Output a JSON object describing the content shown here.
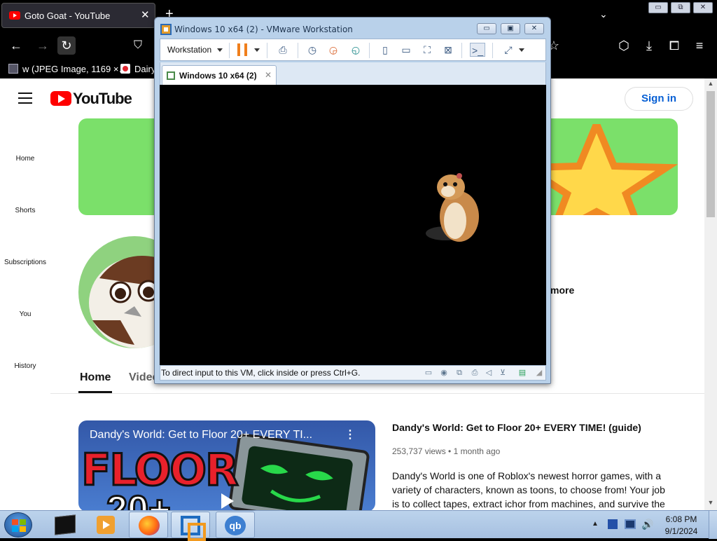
{
  "browser": {
    "tab_title": "Goto Goat - YouTube",
    "tab_close": "✕",
    "new_tab": "+",
    "tabs_list": "⌄",
    "window_min": "▭",
    "window_restore": "⧉",
    "window_close": "✕",
    "nav": {
      "back": "←",
      "forward": "→",
      "reload": "↻",
      "shield": "⛉",
      "star": "☆",
      "pocket": "⬡",
      "download": "⤓",
      "extensions": "⧠",
      "menu": "≡"
    },
    "bookmarks": [
      {
        "label": "w (JPEG Image, 1169 ×…",
        "icon": "image-icon"
      },
      {
        "label": "Dairy",
        "icon": "dairy-queen-icon"
      }
    ]
  },
  "youtube": {
    "logo_text": "YouTube",
    "signin": "Sign in",
    "sidebar": [
      {
        "label": "Home"
      },
      {
        "label": "Shorts"
      },
      {
        "label": "Subscriptions"
      },
      {
        "label": "You"
      },
      {
        "label": "History"
      }
    ],
    "more": "more",
    "tabs": {
      "home": "Home",
      "videos": "Video"
    },
    "video": {
      "thumb_title": "Dandy's World: Get to Floor 20+ EVERY TI...",
      "thumb_more": "⋮",
      "thumb_floor": "FLOOR",
      "thumb_number": "20+",
      "title": "Dandy's World: Get to Floor 20+ EVERY TIME! (guide)",
      "meta": "253,737 views • 1 month ago",
      "description": "Dandy's World is one of Roblox's newest horror games, with a variety of characters, known as toons, to choose from! Your job is to collect tapes, extract ichor from machines, and survive the"
    },
    "scroll_up": "▲",
    "scroll_down": "▼"
  },
  "vmware": {
    "title": "Windows 10 x64 (2) - VMware Workstation",
    "min": "▭",
    "max": "▣",
    "close": "✕",
    "toolbar": {
      "workstation_menu": "Workstation",
      "icons": [
        "send-keys-icon",
        "snapshot-icon",
        "revert-snapshot-icon",
        "snapshot-manager-icon",
        "library-icon",
        "single-window-icon",
        "fullscreen-icon",
        "unity-icon",
        "console-icon",
        "stretch-icon"
      ]
    },
    "tab_label": "Windows 10 x64 (2)",
    "tab_close": "✕",
    "status_text": "To direct input to this VM, click inside or press Ctrl+G."
  },
  "taskbar": {
    "tray_expand": "▲",
    "volume": "🔊",
    "time": "6:08 PM",
    "date": "9/1/2024",
    "qb_label": "qb"
  },
  "colors": {
    "youtube_red": "#ff0000",
    "signin_blue": "#065fd4",
    "banner_green": "#7be06a",
    "vmware_frame": "#b9d1ea",
    "pause_orange": "#f07f1c"
  }
}
